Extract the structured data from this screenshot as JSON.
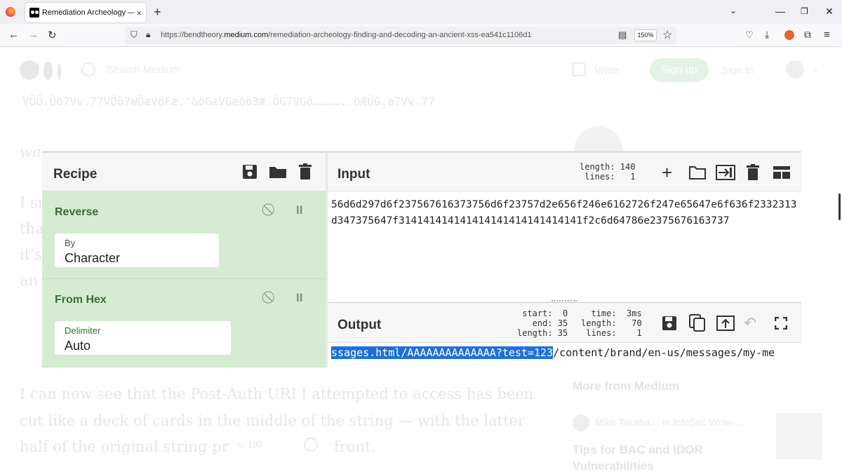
{
  "browser": {
    "tab_title": "Remediation Archeology — Find",
    "tab_close": "×",
    "new_tab": "+",
    "url_prefix": "https://bendtheory.",
    "url_domain": "medium.com",
    "url_path": "/remediation-archeology-finding-and-decoding-an-ancient-xss-ea541c1106d1",
    "zoom": "150%",
    "window_controls": [
      "minimize-icon",
      "restore-icon",
      "close-icon"
    ]
  },
  "medium": {
    "search_placeholder": "Search Medium",
    "write": "Write",
    "sign_up": "Sign up",
    "sign_in": "Sign in",
    "garbled_line": "VÖÖ.Öö7Vv.77VÖö7WÖæVöFæ.'&öGæVGæöö3#.ÖG7VGö…………..öÆÖG.a7Vv.77",
    "partial_word": "wa",
    "left_fragments": [
      "I si",
      "tha",
      "it's",
      "an"
    ],
    "paragraph_lines": [
      "I can now see that the Post-Auth URI I attempted to access has been",
      "cut like a deck of cards in the middle of the string — with the latter",
      "half of the original string pr"
    ],
    "paragraph_tail": "front.",
    "clap_count": "102",
    "more_from": "More from Medium",
    "author_line": "Mike Takaha… in InfoSec Write-…",
    "article_title_lines": [
      "Tips for BAC and IDOR",
      "Vulnerabilities"
    ]
  },
  "cyberchef": {
    "recipe_label": "Recipe",
    "operations": [
      {
        "name": "Reverse",
        "field_label": "By",
        "field_value": "Character"
      },
      {
        "name": "From Hex",
        "field_label": "Delimiter",
        "field_value": "Auto"
      }
    ],
    "input_label": "Input",
    "input_stats": "length: 140\n lines:   1",
    "input_text": "56d6d297d6f237567616373756d6f23757d2e656f246e6162726f247e65647e6f636f2332313d347375647f314141414141414141414141414141f2c6d64786e2375676163737",
    "output_label": "Output",
    "output_stats_left": "start:  0\n  end: 35\nlength: 35",
    "output_stats_right": "  time:  3ms\nlength:   70\n lines:    1",
    "output_selected": "ssages.html/AAAAAAAAAAAAAA?test=123",
    "output_rest": "/content/brand/en-us/messages/my-me"
  }
}
